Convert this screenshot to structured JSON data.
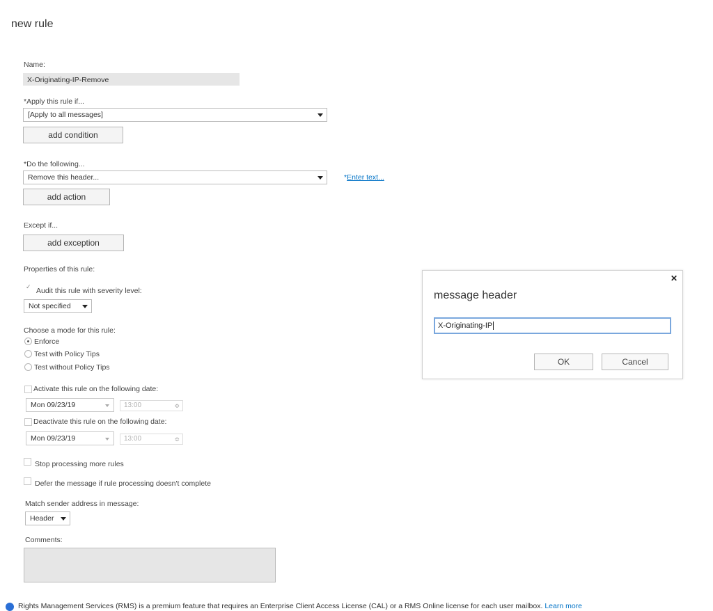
{
  "page_title": "new rule",
  "name_field": {
    "label": "Name:",
    "value": "X-Originating-IP-Remove"
  },
  "apply_if": {
    "label": "*Apply this rule if...",
    "selected": "[Apply to all messages]",
    "add_button": "add condition"
  },
  "do_following": {
    "label": "*Do the following...",
    "selected": "Remove this header...",
    "enter_text_prefix": "*",
    "enter_text_link": "Enter text...",
    "add_button": "add action"
  },
  "except_if": {
    "label": "Except if...",
    "add_button": "add exception"
  },
  "properties": {
    "label": "Properties of this rule:",
    "audit_checkbox_label": "Audit this rule with severity level:",
    "audit_checked": true,
    "severity_selected": "Not specified"
  },
  "mode": {
    "label": "Choose a mode for this rule:",
    "options": [
      "Enforce",
      "Test with Policy Tips",
      "Test without Policy Tips"
    ],
    "selected_index": 0
  },
  "activate": {
    "label": "Activate this rule on the following date:",
    "date": "Mon 09/23/19",
    "time": "13:00"
  },
  "deactivate": {
    "label": "Deactivate this rule on the following date:",
    "date": "Mon 09/23/19",
    "time": "13:00"
  },
  "stop_processing_label": "Stop processing more rules",
  "defer_label": "Defer the message if rule processing doesn't complete",
  "match_sender": {
    "label": "Match sender address in message:",
    "selected": "Header"
  },
  "comments": {
    "label": "Comments:",
    "value": ""
  },
  "footer": {
    "text": "Rights Management Services (RMS) is a premium feature that requires an Enterprise Client Access License (CAL) or a RMS Online license for each user mailbox.",
    "link": "Learn more"
  },
  "dialog": {
    "title": "message header",
    "input_value": "X-Originating-IP",
    "ok_label": "OK",
    "cancel_label": "Cancel"
  },
  "colors": {
    "link": "#0072c6",
    "focus_border": "#7aa7dd",
    "readonly_bg": "#e6e6e6"
  }
}
